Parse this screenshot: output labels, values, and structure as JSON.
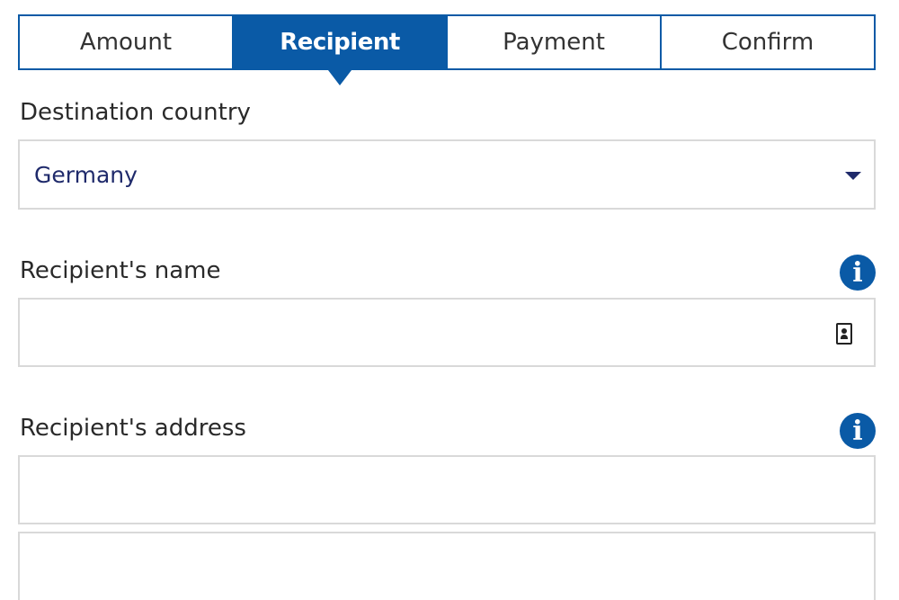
{
  "stepper": {
    "steps": [
      {
        "label": "Amount",
        "active": false
      },
      {
        "label": "Recipient",
        "active": true
      },
      {
        "label": "Payment",
        "active": false
      },
      {
        "label": "Confirm",
        "active": false
      }
    ]
  },
  "destination": {
    "label": "Destination country",
    "value": "Germany"
  },
  "recipient_name": {
    "label": "Recipient's name",
    "value": "",
    "info_icon": "info-icon",
    "contact_icon": "contact-book-icon"
  },
  "recipient_address": {
    "label": "Recipient's address",
    "line1": "",
    "line2": "",
    "info_icon": "info-icon"
  },
  "colors": {
    "accent": "#0a5aa6",
    "select_text": "#1f2a6b",
    "border": "#d9d9d9"
  }
}
